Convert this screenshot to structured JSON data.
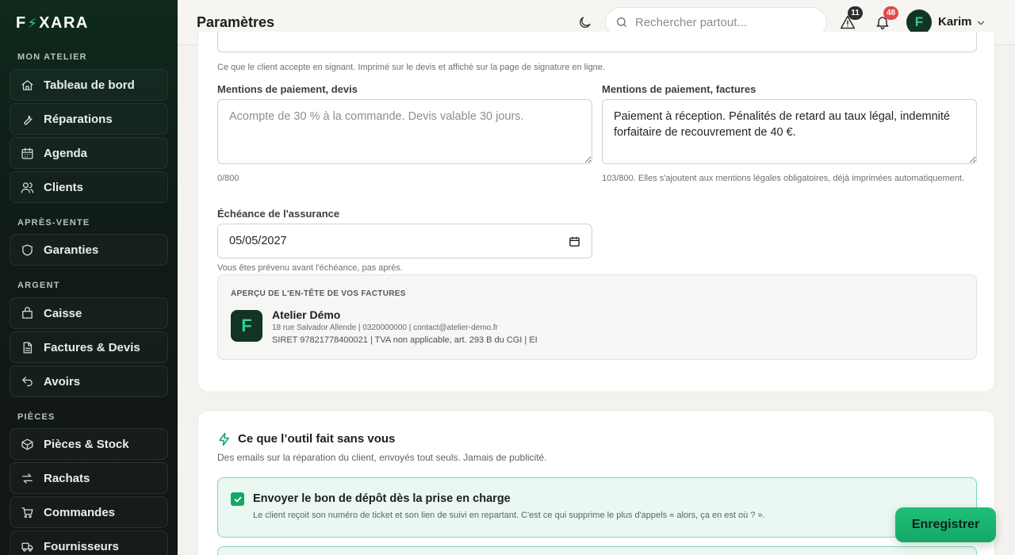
{
  "app": {
    "logo_left": "F",
    "logo_right": "XARA"
  },
  "sidebar": {
    "sections": [
      {
        "label": "MON ATELIER"
      },
      {
        "label": "APRÈS-VENTE"
      },
      {
        "label": "ARGENT"
      },
      {
        "label": "PIÈCES"
      }
    ],
    "items": [
      {
        "label": "Tableau de bord",
        "icon": "home-icon"
      },
      {
        "label": "Réparations",
        "icon": "wrench-icon"
      },
      {
        "label": "Agenda",
        "icon": "calendar-icon"
      },
      {
        "label": "Clients",
        "icon": "users-icon"
      },
      {
        "label": "Garanties",
        "icon": "shield-icon"
      },
      {
        "label": "Caisse",
        "icon": "register-icon"
      },
      {
        "label": "Factures & Devis",
        "icon": "document-icon"
      },
      {
        "label": "Avoirs",
        "icon": "undo-icon"
      },
      {
        "label": "Pièces & Stock",
        "icon": "box-icon"
      },
      {
        "label": "Rachats",
        "icon": "swap-icon"
      },
      {
        "label": "Commandes",
        "icon": "cart-icon"
      },
      {
        "label": "Fournisseurs",
        "icon": "truck-icon"
      }
    ]
  },
  "header": {
    "title": "Paramètres",
    "search_placeholder": "Rechercher partout...",
    "alerts_count": "11",
    "notifications_count": "48",
    "user_initial": "F",
    "user_name": "Karim"
  },
  "settings": {
    "signature_hint": "Ce que le client accepte en signant. Imprimé sur le devis et affiché sur la page de signature en ligne.",
    "quote_payment": {
      "label": "Mentions de paiement, devis",
      "placeholder": "Acompte de 30 % à la commande. Devis valable 30 jours.",
      "value": "",
      "counter": "0/800"
    },
    "invoice_payment": {
      "label": "Mentions de paiement, factures",
      "value": "Paiement à réception. Pénalités de retard au taux légal, indemnité forfaitaire de recouvrement de 40 €.",
      "counter": "103/800. Elles s'ajoutent aux mentions légales obligatoires, déjà imprimées automatiquement."
    },
    "insurance": {
      "label": "Échéance de l'assurance",
      "value": "05/05/2027",
      "hint": "Vous êtes prévenu avant l'échéance, pas après."
    },
    "preview": {
      "title": "APERÇU DE L'EN-TÊTE DE VOS FACTURES",
      "logo_letter": "F",
      "name": "Atelier Démo",
      "line1": "18 rue Salvador Allende | 0320000000 | contact@atelier-demo.fr",
      "line2": "SIRET 97821778400021 | TVA non applicable, art. 293 B du CGI | EI"
    }
  },
  "automation": {
    "title": "Ce que l’outil fait sans vous",
    "subtitle": "Des emails sur la réparation du client, envoyés tout seuls. Jamais de publicité.",
    "options": [
      {
        "title": "Envoyer le bon de dépôt dès la prise en charge",
        "description": "Le client reçoit son numéro de ticket et son lien de suivi en repartant. C'est ce qui supprime le plus d'appels « alors, ça en est où ? ».",
        "checked": true
      }
    ]
  },
  "actions": {
    "save_label": "Enregistrer"
  },
  "colors": {
    "accent": "#14a866",
    "sidebar_bg": "#0f2a1d",
    "badge_red": "#e5484d",
    "badge_dark": "#2b2f2d"
  }
}
